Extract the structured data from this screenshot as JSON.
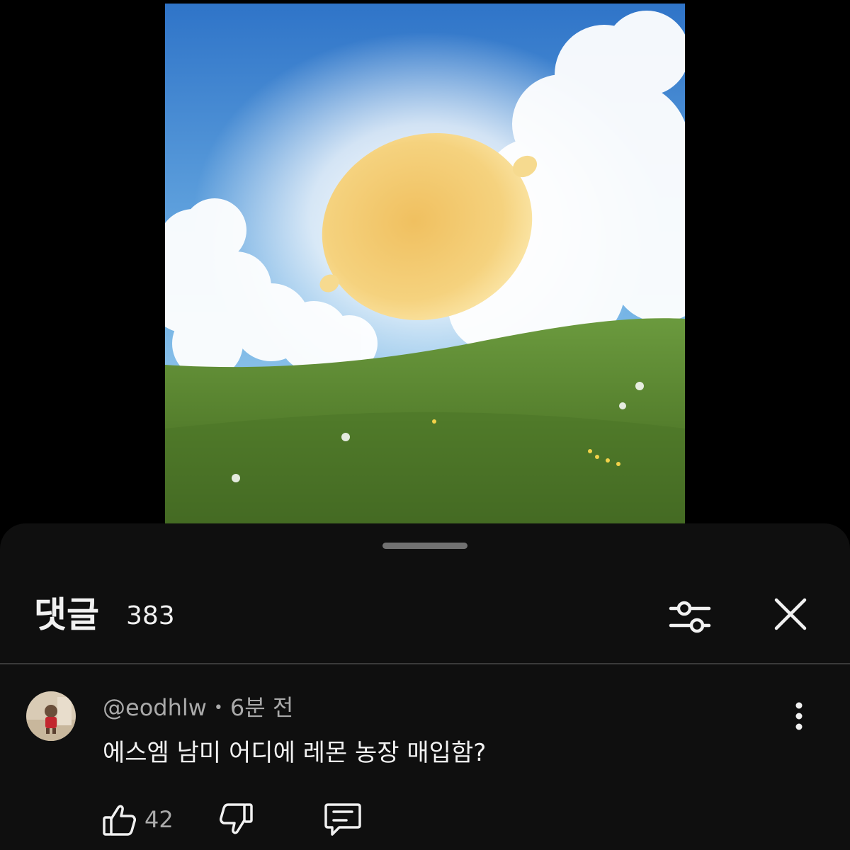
{
  "video": {
    "thumbnail": {
      "subject": "lemon-in-sky-over-grass-hill",
      "colors": {
        "sky_top": "#3a7fcf",
        "sky_bottom": "#a9d3ee",
        "lemon": "#f2cf73",
        "grass": "#5d8a34"
      }
    }
  },
  "comments_panel": {
    "title": "댓글",
    "count": "383",
    "icons": {
      "filter": "sliders-icon",
      "close": "close-icon"
    }
  },
  "comment": {
    "author": "@eodhlw",
    "separator": "•",
    "time": "6분 전",
    "text": "에스엠 남미 어디에 레몬 농장 매입함?",
    "like_count": "42",
    "icons": {
      "like": "thumbs-up-icon",
      "dislike": "thumbs-down-icon",
      "reply": "reply-icon",
      "more": "more-vertical-icon"
    }
  },
  "colors": {
    "background": "#000000",
    "sheet": "#0f0f0f",
    "text_primary": "#f1f1f1",
    "text_secondary": "#aaaaaa",
    "divider": "#3a3a3a"
  }
}
